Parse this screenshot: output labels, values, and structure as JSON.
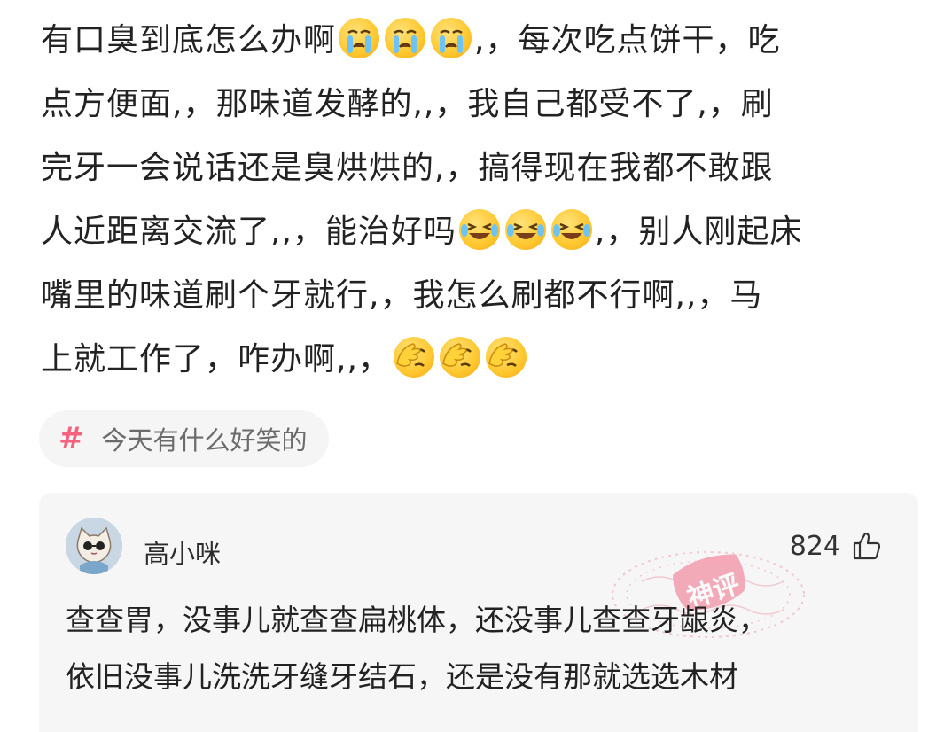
{
  "post": {
    "lines": [
      {
        "pre": "有口臭到底怎么办啊",
        "emoji": "crying-face-icon",
        "emoji_count": 3,
        "post": ",，每次吃点饼干，吃"
      },
      {
        "pre": "点方便面,，那味道发酵的,,，我自己都受不了,，刷",
        "emoji": null,
        "emoji_count": 0,
        "post": ""
      },
      {
        "pre": "完牙一会说话还是臭烘烘的,，搞得现在我都不敢跟",
        "emoji": null,
        "emoji_count": 0,
        "post": ""
      },
      {
        "pre": "人近距离交流了,,，能治好吗",
        "emoji": "laugh-cry-face-icon",
        "emoji_count": 3,
        "post": ",，别人刚起床"
      },
      {
        "pre": "嘴里的味道刷个牙就行,，我怎么刷都不行啊,,，马",
        "emoji": null,
        "emoji_count": 0,
        "post": ""
      },
      {
        "pre": "上就工作了，咋办啊,,，",
        "emoji": "facepalm-face-icon",
        "emoji_count": 3,
        "post": ""
      }
    ]
  },
  "topic": {
    "symbol": "#",
    "label": "今天有什么好笑的"
  },
  "comment": {
    "username": "高小咪",
    "likes": "824",
    "stamp_text": "神评",
    "lines": [
      "查查胃，没事儿就查查扁桃体，还没事儿查查牙龈炎，",
      "依旧没事儿洗洗牙缝牙结石，还是没有那就选选木材"
    ]
  },
  "colors": {
    "topic_hash": "#f3627e",
    "stamp": "#f0a3b0",
    "comment_bg": "#f6f6f7"
  }
}
